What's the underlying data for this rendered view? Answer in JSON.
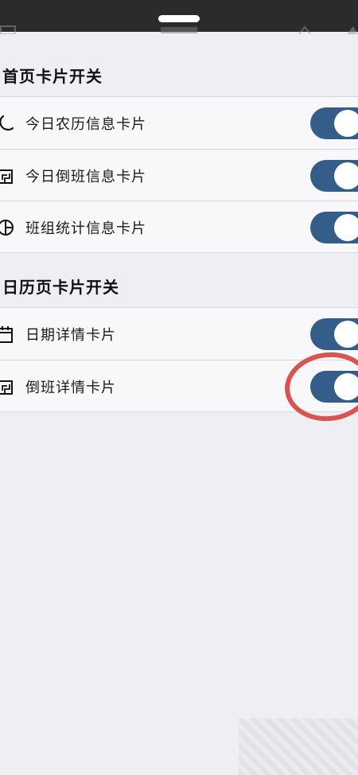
{
  "home_cards": {
    "title": "首页卡片开关",
    "items": [
      {
        "label": "今日农历信息卡片",
        "icon": "moon-icon",
        "enabled": true
      },
      {
        "label": "今日倒班信息卡片",
        "icon": "shift-icon",
        "enabled": true
      },
      {
        "label": "班组统计信息卡片",
        "icon": "pie-chart-icon",
        "enabled": true
      }
    ]
  },
  "calendar_cards": {
    "title": "日历页卡片开关",
    "items": [
      {
        "label": "日期详情卡片",
        "icon": "calendar-icon",
        "enabled": true
      },
      {
        "label": "倒班详情卡片",
        "icon": "shift-icon",
        "enabled": true
      }
    ]
  },
  "colors": {
    "toggle_on": "#345d8a",
    "highlight": "#d9534f",
    "background": "#efeff3"
  }
}
